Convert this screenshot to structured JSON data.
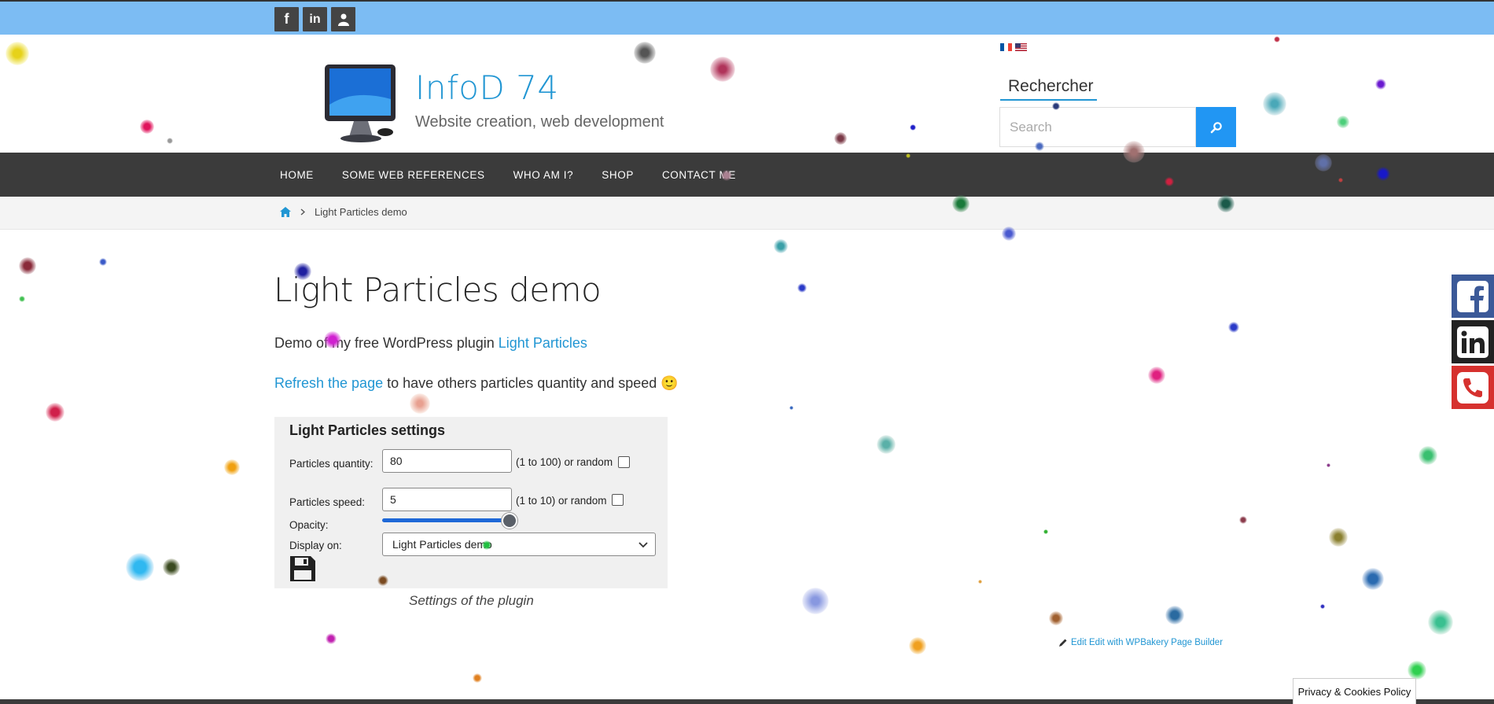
{
  "topbar": {
    "social": [
      "facebook-icon",
      "linkedin-icon",
      "user-icon"
    ],
    "color": "#7cbcf3"
  },
  "header": {
    "site_title": "InfoD 74",
    "site_description": "Website creation, web development",
    "flags": [
      "flag-fr-icon",
      "flag-us-icon"
    ],
    "search": {
      "title": "Rechercher",
      "placeholder": "Search",
      "button_icon": "search-icon"
    }
  },
  "nav": {
    "items": [
      {
        "label": "HOME"
      },
      {
        "label": "SOME WEB REFERENCES"
      },
      {
        "label": "WHO AM I?"
      },
      {
        "label": "SHOP"
      },
      {
        "label": "CONTACT ME"
      }
    ]
  },
  "breadcrumb": {
    "home_icon": "home-icon",
    "current": "Light Particles demo"
  },
  "main": {
    "title": "Light Particles demo",
    "intro_prefix": "Demo of my free WordPress plugin ",
    "intro_link": "Light Particles",
    "refresh_link": "Refresh the page",
    "refresh_suffix": " to have others particles quantity and speed ",
    "emoji": "🙂"
  },
  "settings": {
    "title": "Light Particles settings",
    "quantity_label": "Particles quantity:",
    "quantity_value": "80",
    "quantity_hint": "(1 to 100) or random",
    "speed_label": "Particles speed:",
    "speed_value": "5",
    "speed_hint": "(1 to 10) or random",
    "opacity_label": "Opacity:",
    "opacity_level": 1.0,
    "display_label": "Display on:",
    "display_value": "Light Particles demo",
    "save_icon": "floppy-disk-icon"
  },
  "caption": "Settings of the plugin",
  "edit_link": "Edit Edit with WPBakery Page Builder",
  "side_social": [
    "facebook-icon",
    "linkedin-icon",
    "phone-icon"
  ],
  "cookie": "Privacy & Cookies Policy",
  "colors": {
    "accent": "#2196d3",
    "nav_bg": "#3b3b3b",
    "search_btn": "#2196f3"
  }
}
